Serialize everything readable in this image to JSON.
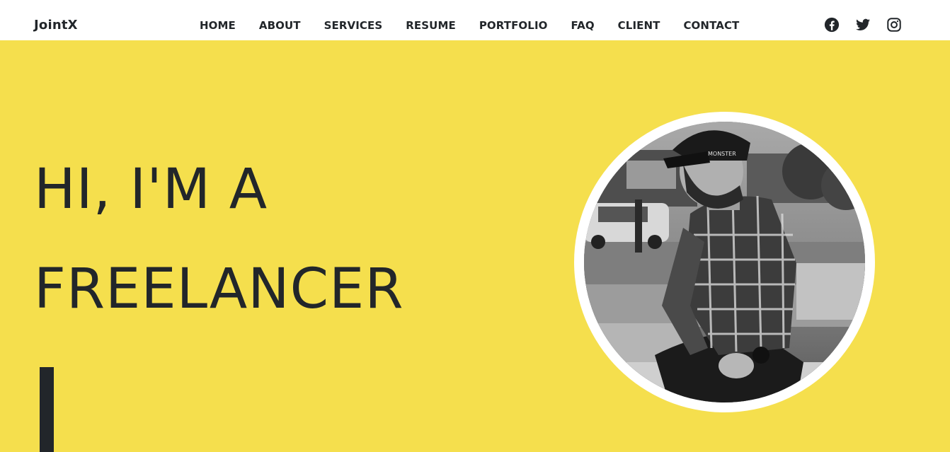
{
  "brand": "JointX",
  "nav": {
    "items": [
      {
        "label": "HOME"
      },
      {
        "label": "ABOUT"
      },
      {
        "label": "SERVICES"
      },
      {
        "label": "RESUME"
      },
      {
        "label": "PORTFOLIO"
      },
      {
        "label": "FAQ"
      },
      {
        "label": "CLIENT"
      },
      {
        "label": "CONTACT"
      }
    ]
  },
  "socials": [
    {
      "icon": "facebook-icon"
    },
    {
      "icon": "twitter-icon"
    },
    {
      "icon": "instagram-icon"
    }
  ],
  "hero": {
    "line1": "HI, I'M A",
    "line2": "FREELANCER"
  },
  "photo": {
    "cap_text": "MONSTER"
  },
  "colors": {
    "hero_bg": "#f5df4d",
    "text": "#22262a",
    "nav_bg": "#ffffff"
  }
}
